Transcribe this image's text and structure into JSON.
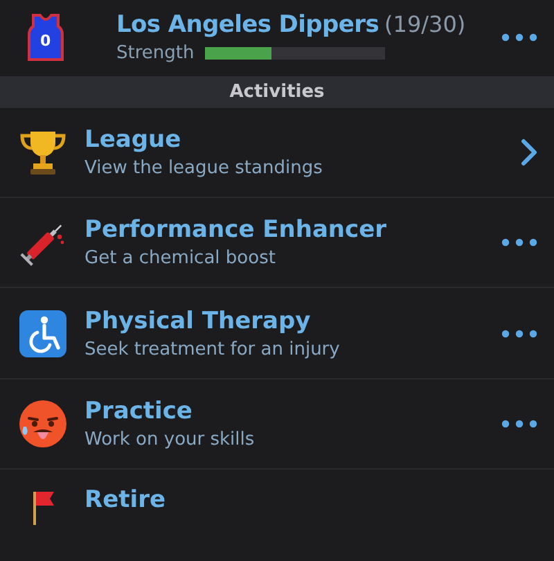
{
  "team": {
    "jersey_number": "0",
    "name": "Los Angeles Dippers",
    "record": "(19/30)",
    "strength_label": "Strength",
    "level": 0.37
  },
  "section": {
    "title": "Activities"
  },
  "activities": [
    {
      "kind": "trophy",
      "title": "League",
      "subtitle": "View the league standings"
    },
    {
      "kind": "syringe",
      "title": "Performance Enhancer",
      "subtitle": "Get a chemical boost"
    },
    {
      "kind": "wheelchair",
      "title": "Physical Therapy",
      "subtitle": "Seek treatment for an injury"
    },
    {
      "kind": "face",
      "title": "Practice",
      "subtitle": "Work on your skills"
    },
    {
      "kind": "flag",
      "title": "Retire"
    }
  ]
}
